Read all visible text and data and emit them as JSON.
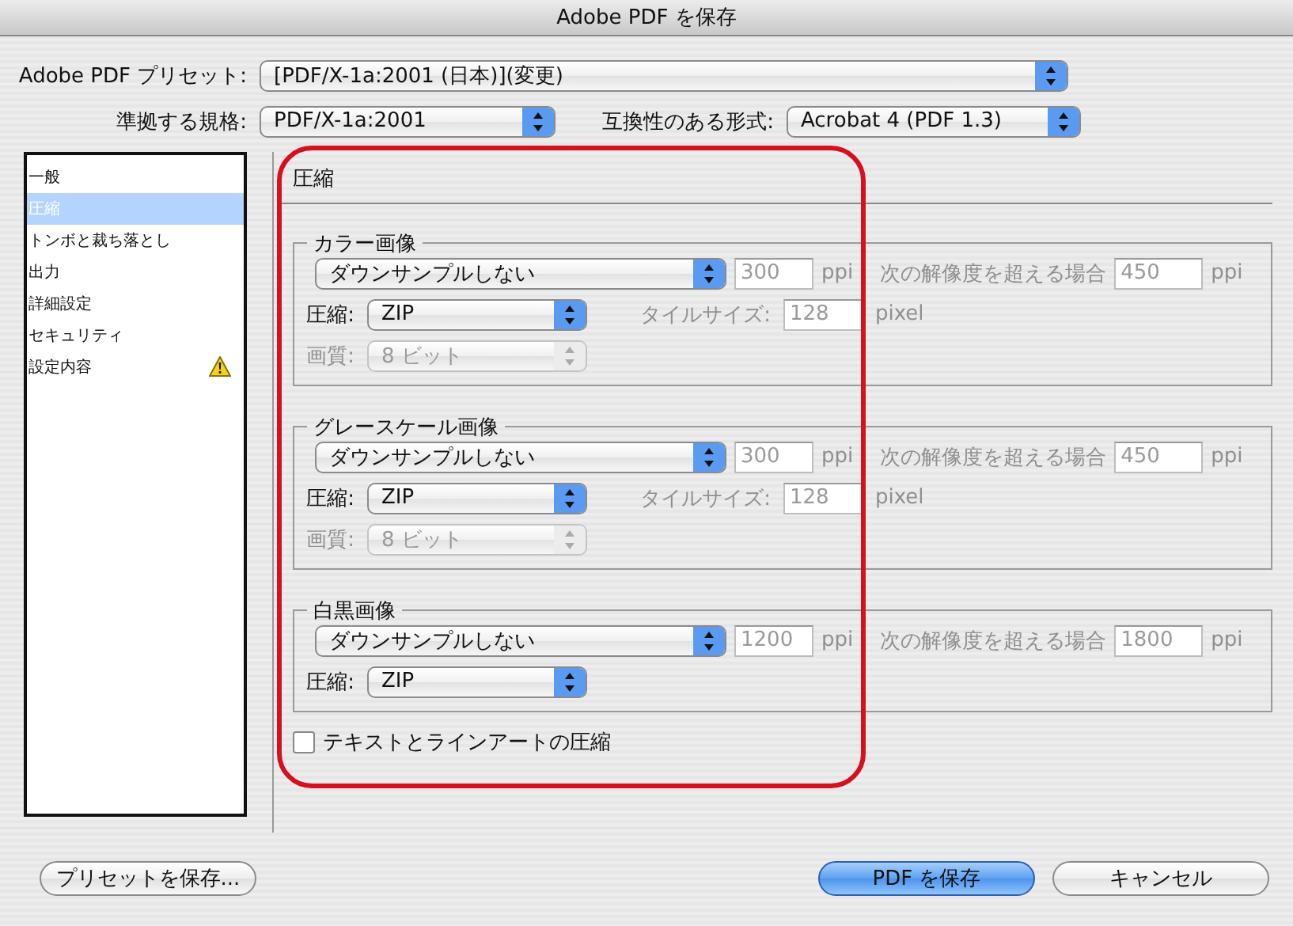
{
  "window": {
    "title": "Adobe PDF を保存"
  },
  "preset": {
    "label": "Adobe PDF プリセット:",
    "value": "[PDF/X-1a:2001 (日本)](変更)"
  },
  "standard": {
    "label": "準拠する規格:",
    "value": "PDF/X-1a:2001"
  },
  "compatibility": {
    "label": "互換性のある形式:",
    "value": "Acrobat 4 (PDF 1.3)"
  },
  "sidebar": {
    "items": [
      {
        "label": "一般",
        "selected": false,
        "warning": false
      },
      {
        "label": "圧縮",
        "selected": true,
        "warning": false
      },
      {
        "label": "トンボと裁ち落とし",
        "selected": false,
        "warning": false
      },
      {
        "label": "出力",
        "selected": false,
        "warning": false
      },
      {
        "label": "詳細設定",
        "selected": false,
        "warning": false
      },
      {
        "label": "セキュリティ",
        "selected": false,
        "warning": false
      },
      {
        "label": "設定内容",
        "selected": false,
        "warning": true
      }
    ]
  },
  "section": {
    "title": "圧縮"
  },
  "groups": [
    {
      "title": "カラー画像",
      "downsample": {
        "value": "ダウンサンプルしない",
        "resolution": "300",
        "unit": "ppi",
        "threshold_label": "次の解像度を超える場合",
        "threshold": "450",
        "threshold_unit": "ppi",
        "disabled": true
      },
      "compression": {
        "label": "圧縮:",
        "value": "ZIP"
      },
      "tile": {
        "label": "タイルサイズ:",
        "value": "128",
        "unit": "pixel",
        "disabled": true
      },
      "quality": {
        "label": "画質:",
        "value": "8 ビット",
        "disabled": true
      }
    },
    {
      "title": "グレースケール画像",
      "downsample": {
        "value": "ダウンサンプルしない",
        "resolution": "300",
        "unit": "ppi",
        "threshold_label": "次の解像度を超える場合",
        "threshold": "450",
        "threshold_unit": "ppi",
        "disabled": true
      },
      "compression": {
        "label": "圧縮:",
        "value": "ZIP"
      },
      "tile": {
        "label": "タイルサイズ:",
        "value": "128",
        "unit": "pixel",
        "disabled": true
      },
      "quality": {
        "label": "画質:",
        "value": "8 ビット",
        "disabled": true
      }
    },
    {
      "title": "白黒画像",
      "downsample": {
        "value": "ダウンサンプルしない",
        "resolution": "1200",
        "unit": "ppi",
        "threshold_label": "次の解像度を超える場合",
        "threshold": "1800",
        "threshold_unit": "ppi",
        "disabled": true
      },
      "compression": {
        "label": "圧縮:",
        "value": "ZIP"
      }
    }
  ],
  "checkbox": {
    "label": "テキストとラインアートの圧縮",
    "checked": false
  },
  "buttons": [
    {
      "label": "プリセットを保存...",
      "kind": "normal"
    },
    {
      "label": "PDF を保存",
      "kind": "default"
    },
    {
      "label": "キャンセル",
      "kind": "normal"
    }
  ]
}
